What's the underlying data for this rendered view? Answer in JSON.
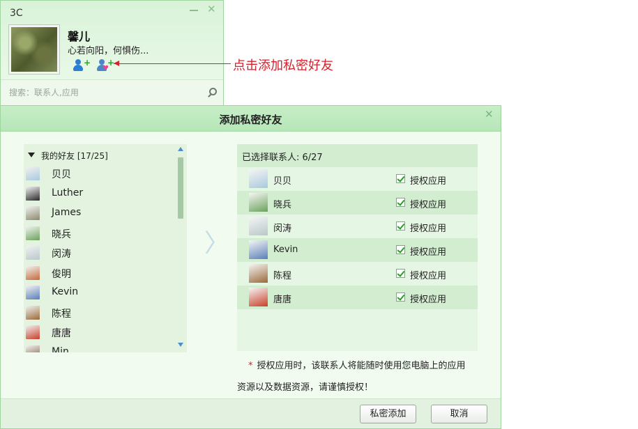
{
  "mini": {
    "title": "3C",
    "nickname": "馨儿",
    "signature": "心若向阳，何惧伤...",
    "search_placeholder": "搜索：联系人,应用"
  },
  "annotation": {
    "callout": "点击添加私密好友",
    "color": "#d6202b"
  },
  "dialog": {
    "title": "添加私密好友",
    "group_label": "我的好友 [17/25]",
    "friends": [
      {
        "name": "贝贝",
        "color": "#a9c9dc"
      },
      {
        "name": "Luther",
        "color": "#2b2b2b"
      },
      {
        "name": "James",
        "color": "#8a8a6e"
      },
      {
        "name": "晓兵",
        "color": "#6aa35a"
      },
      {
        "name": "闵涛",
        "color": "#b9c7c9"
      },
      {
        "name": "俊明",
        "color": "#c46a3a"
      },
      {
        "name": "Kevin",
        "color": "#5a7fb8"
      },
      {
        "name": "陈程",
        "color": "#9a6a3a"
      },
      {
        "name": "唐唐",
        "color": "#c8402a"
      },
      {
        "name": "Min",
        "color": "#7a5a3a"
      }
    ],
    "selected_label": "已选择联系人: 6/27",
    "selected": [
      {
        "name": "贝贝",
        "auth": "授权应用",
        "color": "#a9c9dc"
      },
      {
        "name": "晓兵",
        "auth": "授权应用",
        "color": "#6aa35a"
      },
      {
        "name": "闵涛",
        "auth": "授权应用",
        "color": "#b9c7c9"
      },
      {
        "name": "Kevin",
        "auth": "授权应用",
        "color": "#5a7fb8"
      },
      {
        "name": "陈程",
        "auth": "授权应用",
        "color": "#9a6a3a"
      },
      {
        "name": "唐唐",
        "auth": "授权应用",
        "color": "#c8402a"
      }
    ],
    "note_star": "*",
    "note_line1": "授权应用时，该联系人将能随时使用您电脑上的应用",
    "note_line2": "资源以及数据资源，请谨慎授权！",
    "btn_add": "私密添加",
    "btn_cancel": "取消"
  },
  "colors": {
    "accent_green": "#b6e6b8",
    "panel_green": "#e3f3e0",
    "check_green": "#2a9a2a"
  }
}
